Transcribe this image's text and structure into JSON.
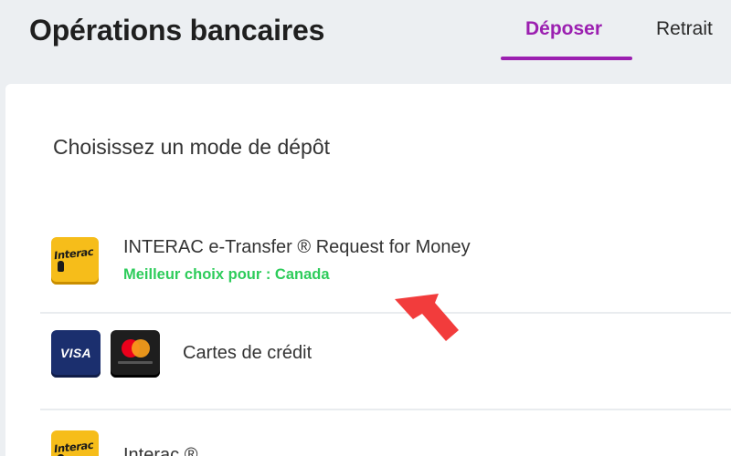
{
  "header": {
    "title": "Opérations bancaires",
    "tabs": [
      {
        "label": "Déposer",
        "active": true
      },
      {
        "label": "Retrait",
        "active": false
      }
    ]
  },
  "main": {
    "section_title": "Choisissez un mode de dépôt",
    "methods": [
      {
        "name": "INTERAC e-Transfer ® Request for Money",
        "best_choice": "Meilleur choix pour : Canada",
        "icon": "interac-logo-icon"
      },
      {
        "name": "Cartes de crédit",
        "icons": [
          "visa-logo-icon",
          "mastercard-logo-icon"
        ]
      },
      {
        "name": "Interac ®",
        "icon": "interac-logo-icon"
      }
    ],
    "logo_texts": {
      "interac": "Interac",
      "visa": "VISA"
    }
  },
  "colors": {
    "accent": "#9b1fb0",
    "best_choice": "#2ecc5b",
    "arrow": "#f23c3c",
    "interac_yellow": "#f6bd1a",
    "visa_blue": "#1b2f6e"
  },
  "annotation": {
    "icon": "red-arrow-icon"
  }
}
